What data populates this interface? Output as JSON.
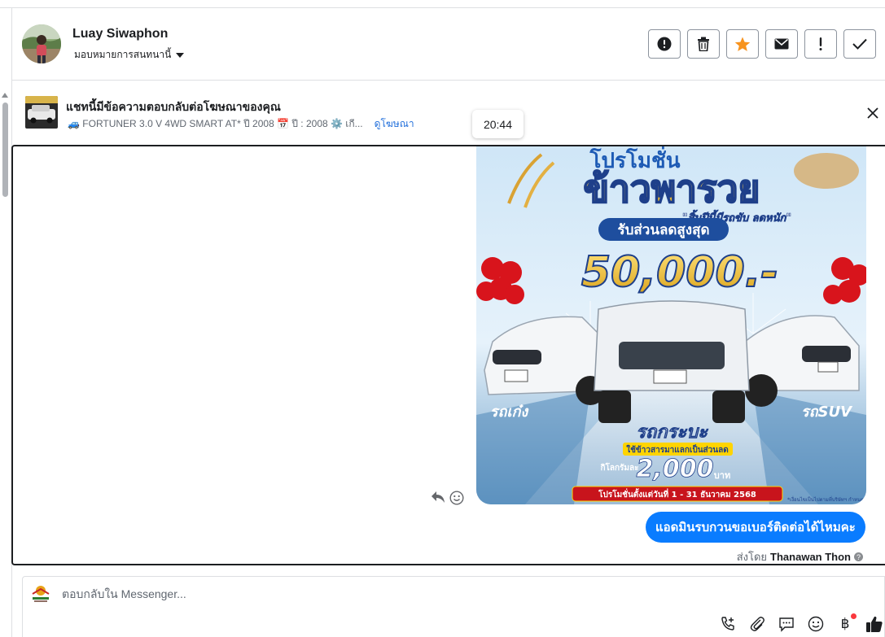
{
  "header": {
    "user_name": "Luay Siwaphon",
    "assign_label": "มอบหมายการสนทนานี้",
    "actions": [
      {
        "name": "report-spam-button",
        "icon": "alert-circle-icon"
      },
      {
        "name": "delete-button",
        "icon": "trash-icon"
      },
      {
        "name": "star-button",
        "icon": "star-icon"
      },
      {
        "name": "mark-unread-button",
        "icon": "envelope-icon"
      },
      {
        "name": "mark-important-button",
        "icon": "exclamation-icon"
      },
      {
        "name": "mark-done-button",
        "icon": "check-icon"
      }
    ]
  },
  "ad_banner": {
    "title": "แชทนี้มีข้อความตอบกลับต่อโฆษณาของคุณ",
    "subtitle": "🚙 FORTUNER 3.0 V 4WD SMART AT* ปี 2008 📅 ปี : 2008 ⚙️ เกี...",
    "link_label": "ดูโฆษณา"
  },
  "tooltip_time": "20:44",
  "promo": {
    "headline_top": "โปรโมชั่น",
    "headline_main": "ข้าวพารวย",
    "tagline": "\"สิ้นปีนี้มีรถขับ ลดหนัก\"",
    "discount_label": "รับส่วนลดสูงสุด",
    "discount_value": "50,000.-",
    "left_label": "รถเก๋ง",
    "right_label": "รถSUV",
    "center_label": "รถกระบะ",
    "rice_label": "ใช้ข้าวสารมาแลกเป็นส่วนลด",
    "per_kg": "กิโลกรัมละ",
    "price": "2,000",
    "baht": "บาท",
    "period": "โปรโมชั่นตั้งแต่วันที่ 1 - 31 ธันวาคม 2568",
    "fine_print": "*เงื่อนไขเป็นไปตามที่บริษัทฯ กำหนด"
  },
  "message": {
    "text": "แอดมินรบกวนขอเบอร์ติดต่อได้ไหมคะ",
    "sent_by_label": "ส่งโดย",
    "sender": "Thanawan Thon"
  },
  "composer": {
    "placeholder": "ตอบกลับใน Messenger...",
    "tools": [
      "add-call-icon",
      "paperclip-icon",
      "saved-reply-icon",
      "emoji-icon",
      "baht-payment-icon",
      "thumbs-up-icon"
    ]
  },
  "colors": {
    "accent": "#0a7cff",
    "link": "#216fdb",
    "star": "#f7931e",
    "notification": "#fa383e"
  }
}
